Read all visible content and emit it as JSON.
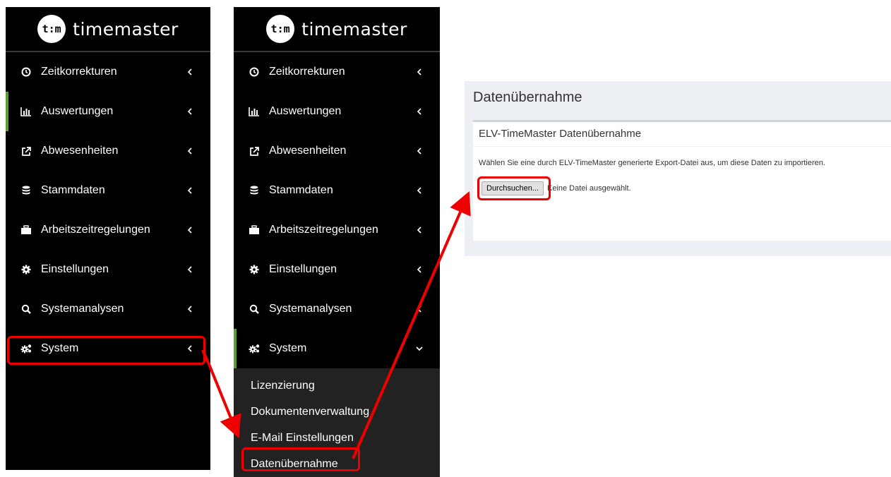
{
  "brand": {
    "logo_text": "t:m",
    "name": "timemaster"
  },
  "menu": [
    {
      "label": "Zeitkorrekturen",
      "icon": "clock-icon"
    },
    {
      "label": "Auswertungen",
      "icon": "bar-chart-icon"
    },
    {
      "label": "Abwesenheiten",
      "icon": "external-link-icon"
    },
    {
      "label": "Stammdaten",
      "icon": "database-icon"
    },
    {
      "label": "Arbeitszeitregelungen",
      "icon": "briefcase-icon"
    },
    {
      "label": "Einstellungen",
      "icon": "gear-icon"
    },
    {
      "label": "Systemanalysen",
      "icon": "search-icon"
    },
    {
      "label": "System",
      "icon": "cogs-icon"
    }
  ],
  "submenu": [
    {
      "label": "Lizenzierung"
    },
    {
      "label": "Dokumentenverwaltung"
    },
    {
      "label": "E-Mail Einstellungen"
    },
    {
      "label": "Datenübernahme"
    }
  ],
  "content": {
    "page_title": "Datenübernahme",
    "box_title": "ELV-TimeMaster Datenübernahme",
    "description": "Wählen Sie eine durch ELV-TimeMaster generierte Export-Datei aus, um diese Daten zu importieren.",
    "browse_button": "Durchsuchen...",
    "no_file_text": "Keine Datei ausgewählt."
  },
  "colors": {
    "active_accent": "#5aa02c",
    "highlight": "#ee0000",
    "sidebar_bg": "#000000"
  }
}
